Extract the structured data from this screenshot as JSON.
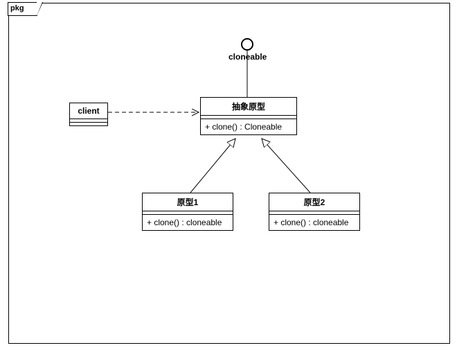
{
  "package": {
    "label": "pkg"
  },
  "interface": {
    "label": "cloneable"
  },
  "classes": {
    "client": {
      "name": "client",
      "ops": ""
    },
    "abstract": {
      "name": "抽象原型",
      "ops": "+ clone() : Cloneable"
    },
    "proto1": {
      "name": "原型1",
      "ops": "+ clone() : cloneable"
    },
    "proto2": {
      "name": "原型2",
      "ops": "+ clone() : cloneable"
    }
  },
  "chart_data": {
    "type": "uml-class-diagram",
    "package": "pkg",
    "elements": [
      {
        "id": "cloneable",
        "kind": "interface",
        "name": "cloneable"
      },
      {
        "id": "client",
        "kind": "class",
        "name": "client",
        "operations": []
      },
      {
        "id": "abstract",
        "kind": "class",
        "name": "抽象原型",
        "operations": [
          "+ clone() : Cloneable"
        ]
      },
      {
        "id": "proto1",
        "kind": "class",
        "name": "原型1",
        "operations": [
          "+ clone() : cloneable"
        ]
      },
      {
        "id": "proto2",
        "kind": "class",
        "name": "原型2",
        "operations": [
          "+ clone() : cloneable"
        ]
      }
    ],
    "relations": [
      {
        "from": "client",
        "to": "abstract",
        "type": "dependency"
      },
      {
        "from": "abstract",
        "to": "cloneable",
        "type": "realization"
      },
      {
        "from": "proto1",
        "to": "abstract",
        "type": "generalization"
      },
      {
        "from": "proto2",
        "to": "abstract",
        "type": "generalization"
      }
    ]
  }
}
